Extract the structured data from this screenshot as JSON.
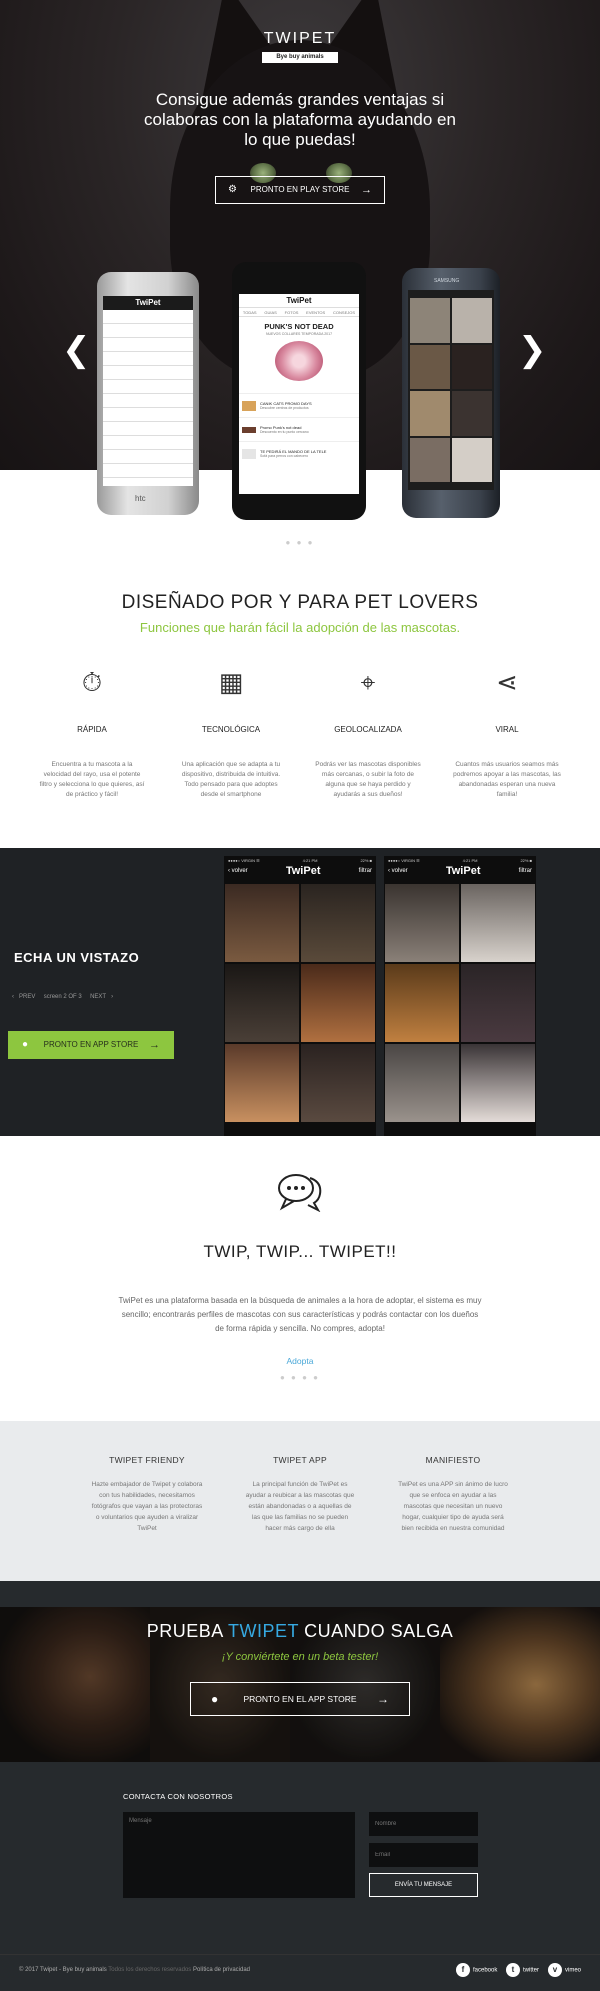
{
  "hero": {
    "brand": "TWIPET",
    "tagline": "Bye buy animals",
    "headline": "Consigue además grandes ventajas si colaboras con la plataforma ayudando en lo que puedas!",
    "cta": "PRONTO EN PLAY STORE",
    "phones": {
      "left": {
        "app_title": "TwiPet",
        "brand": "htc"
      },
      "center": {
        "app_title": "TwiPet",
        "tabs": [
          "TODAS",
          "GUIAS",
          "FOTOS",
          "EVENTOS",
          "CONSEJOS"
        ],
        "promo_title": "PUNK'S NOT DEAD",
        "promo_sub": "NUEVOS COLLARES TEMPORADA 2017",
        "items": [
          {
            "title": "CANIK CATS PROMO DAYS",
            "sub": "Descubre centros de productos"
          },
          {
            "title": "Promo Punk's not dead",
            "sub": "Descuento en tu punto cercano"
          },
          {
            "title": "TE PEDIRÁ EL MANDO DE LA TELE",
            "sub": "Sofá para perros con cabecero"
          }
        ]
      },
      "right": {
        "brand": "SAMSUNG"
      }
    }
  },
  "features": {
    "title": "DISEÑADO POR Y PARA PET LOVERS",
    "subtitle": "Funciones que harán fácil la adopción de las mascotas.",
    "items": [
      {
        "name": "RÁPIDA",
        "icon": "stopwatch-icon",
        "desc": "Encuentra a tu mascota a la velocidad del rayo, usa el potente filtro y selecciona lo que quieres, así de práctico y fácil!"
      },
      {
        "name": "TECNOLÓGICA",
        "icon": "layout-icon",
        "desc": "Una aplicación que se adapta a tu dispositivo, distribuida de intuitiva. Todo pensado para que adoptes desde el smartphone"
      },
      {
        "name": "GEOLOCALIZADA",
        "icon": "map-pin-icon",
        "desc": "Podrás ver las mascotas disponibles más cercanas, o subir la foto de alguna que se haya perdido y ayudarás a sus dueños!"
      },
      {
        "name": "VIRAL",
        "icon": "share-icon",
        "desc": "Cuantos más usuarios seamos más podremos apoyar a las mascotas, las abandonadas esperan una nueva familia!"
      }
    ]
  },
  "vistazo": {
    "title": "ECHA UN VISTAZO",
    "prev": "PREV",
    "pager": "screen 2 OF 3",
    "next": "NEXT",
    "cta": "PRONTO EN APP STORE",
    "screens": [
      {
        "carrier": "●●●●○ VIRGIN ☰",
        "time": "4:21 PM",
        "battery": "22% ■",
        "back": "‹ volver",
        "title": "TwiPet",
        "filter": "filtrar"
      },
      {
        "carrier": "●●●●○ VIRGIN ☰",
        "time": "4:21 PM",
        "battery": "22% ■",
        "back": "‹ volver",
        "title": "TwiPet",
        "filter": "filtrar"
      }
    ]
  },
  "twipet": {
    "title": "TWIP, TWIP... TWIPET!!",
    "text": "TwiPet es una plataforma basada en la búsqueda de animales a la hora de adoptar, el sistema es muy sencillo; encontrarás perfiles de mascotas con sus características y podrás contactar con los dueños de forma rápida y sencilla. No compres, adopta!",
    "link": "Adopta"
  },
  "info": [
    {
      "title": "TWIPET FRIENDY",
      "text": "Hazte embajador de Twipet y colabora con tus habilidades, necesitamos fotógrafos que vayan a las protectoras o voluntarios que ayuden a viralizar TwiPet"
    },
    {
      "title": "TWIPET APP",
      "text": "La principal función de TwiPet es ayudar a reubicar a las mascotas que están abandonadas o a aquellas de las que las familias no se pueden hacer más cargo de ella"
    },
    {
      "title": "MANIFIESTO",
      "text": "TwiPet es una APP sin ánimo de lucro que se enfoca en ayudar a las mascotas que necesitan un nuevo hogar, cualquier tipo de ayuda será bien recibida en nuestra comunidad"
    }
  ],
  "prueba": {
    "title_a": "PRUEBA",
    "title_b": "TWIPET",
    "title_c": "CUANDO SALGA",
    "subtitle": "¡Y conviértete en un beta tester!",
    "cta": "PRONTO EN EL APP STORE"
  },
  "contact": {
    "title": "CONTACTA CON NOSOTROS",
    "message_placeholder": "Mensaje",
    "name_placeholder": "Nombre",
    "email_placeholder": "Email",
    "send": "ENVÍA TU MENSAJE"
  },
  "footer": {
    "copyright": "© 2017 Twipet - Bye buy animals",
    "rights": "Todos los derechos reservados",
    "privacy": "Política de privacidad",
    "social": [
      {
        "label": "facebook",
        "icon": "facebook-icon"
      },
      {
        "label": "twitter",
        "icon": "twitter-icon"
      },
      {
        "label": "vimeo",
        "icon": "vimeo-icon"
      }
    ]
  },
  "colors": {
    "accent_green": "#8dc63f",
    "accent_blue": "#36a9e1",
    "dark": "#1f2225"
  }
}
